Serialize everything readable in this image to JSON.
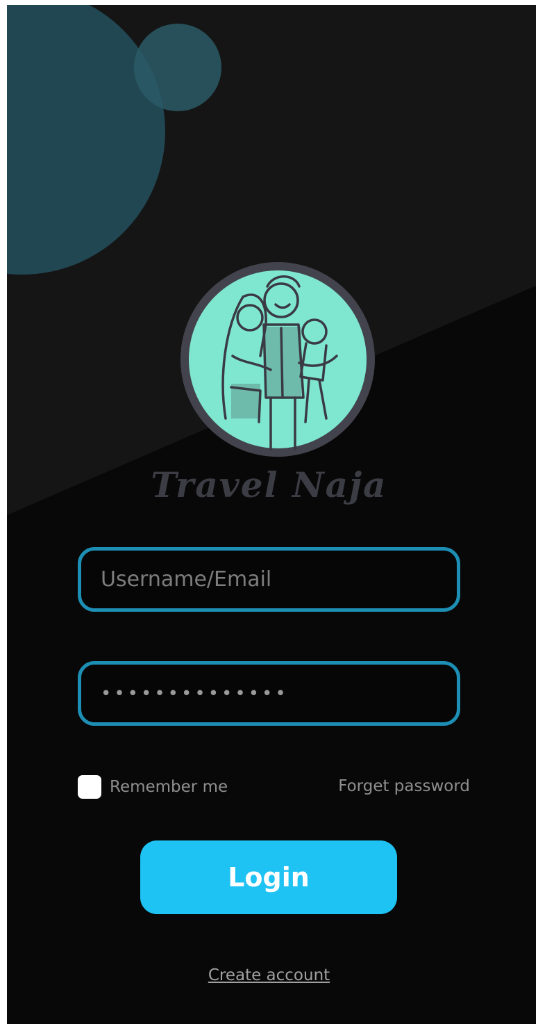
{
  "app": {
    "brand_name": "Travel Naja",
    "logo_icon": "family-logo-icon"
  },
  "colors": {
    "background": "#080808",
    "accent_circle": "#214752",
    "field_border": "#1d8fb5",
    "login_button": "#1ec2f3",
    "logo_fill": "#7fe6cf",
    "logo_ring": "#43434d"
  },
  "form": {
    "username": {
      "placeholder": "Username/Email",
      "value": ""
    },
    "password": {
      "value": "••••••••••••••"
    },
    "remember_label": "Remember me",
    "remember_checked": false,
    "forgot_label": "Forget password",
    "login_label": "Login"
  },
  "footer": {
    "create_account_label": "Create account"
  }
}
